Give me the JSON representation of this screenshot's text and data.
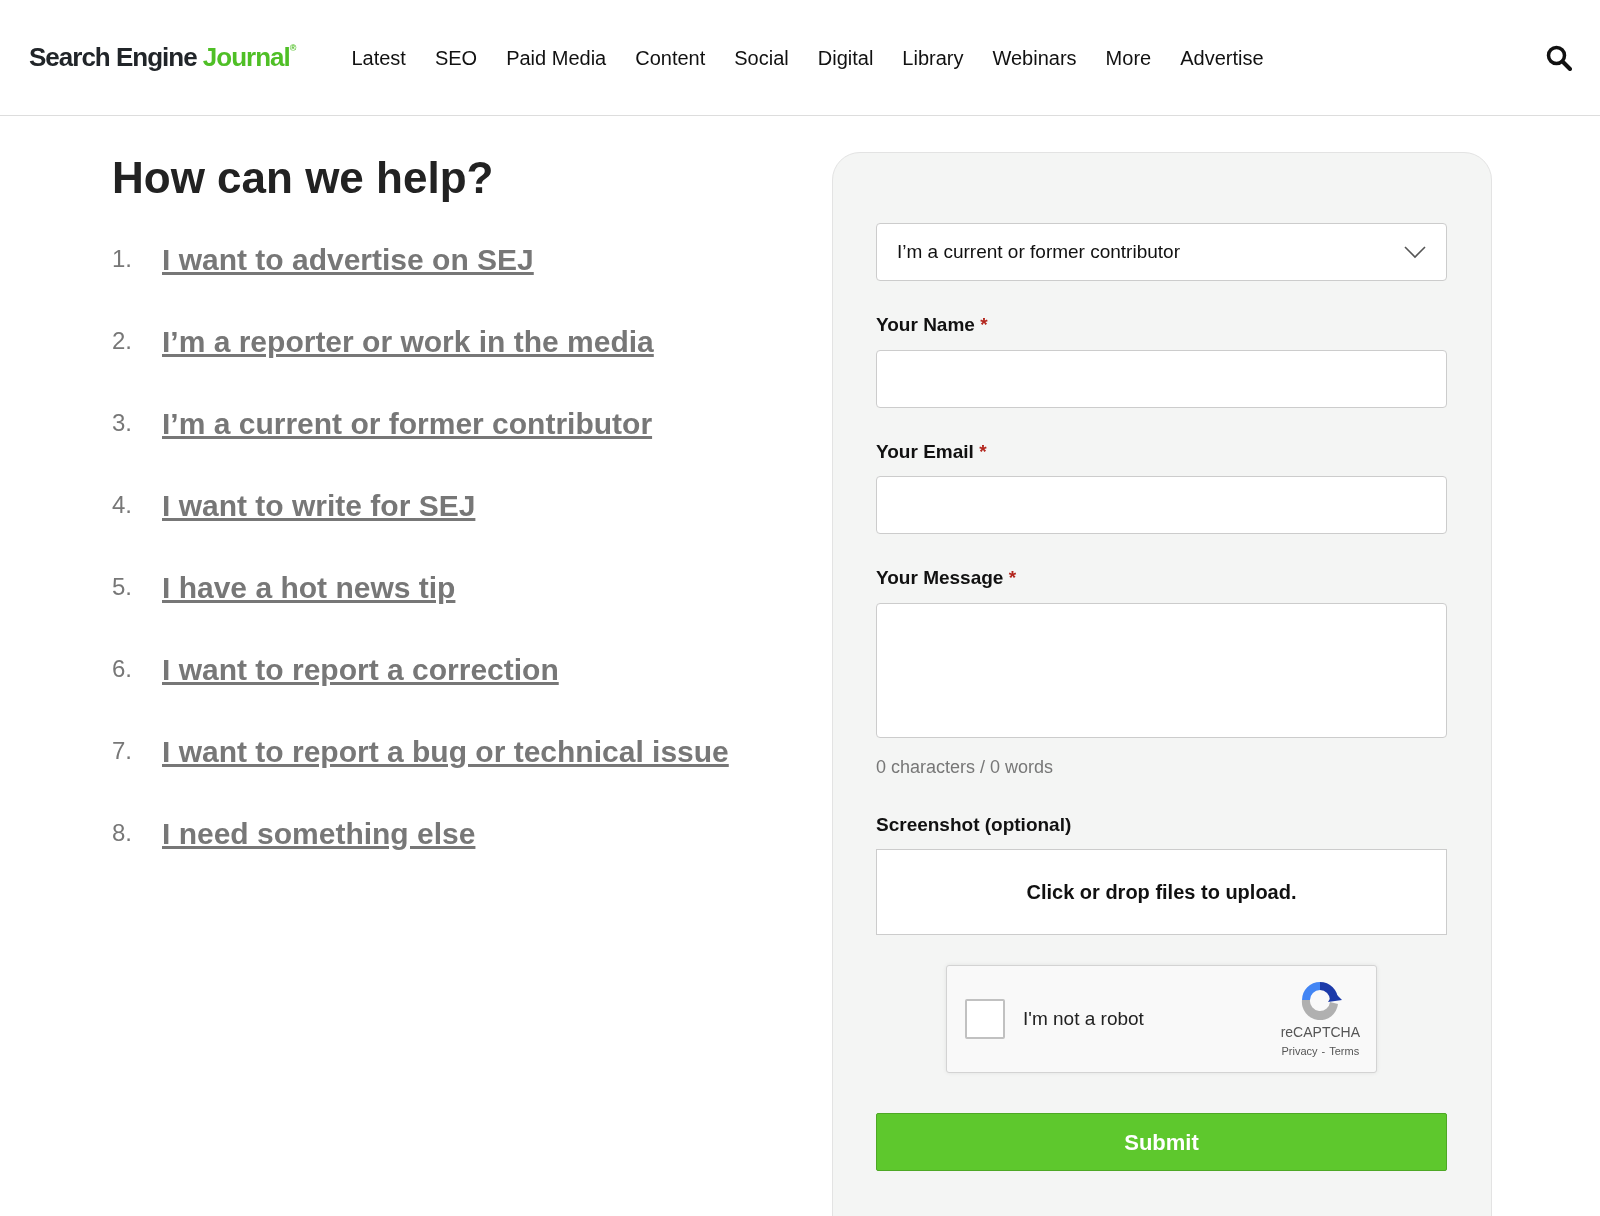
{
  "header": {
    "logo": {
      "part_1": "Search Engine",
      "part_2": "Journal",
      "mark": "®"
    },
    "nav": [
      "Latest",
      "SEO",
      "Paid Media",
      "Content",
      "Social",
      "Digital",
      "Library",
      "Webinars",
      "More",
      "Advertise"
    ]
  },
  "help": {
    "title": "How can we help?",
    "options": [
      {
        "number": "1.",
        "label": "I want to advertise on SEJ"
      },
      {
        "number": "2.",
        "label": "I’m a reporter or work in the media"
      },
      {
        "number": "3.",
        "label": "I’m a current or former contributor"
      },
      {
        "number": "4.",
        "label": "I want to write for SEJ"
      },
      {
        "number": "5.",
        "label": "I have a hot news tip"
      },
      {
        "number": "6.",
        "label": "I want to report a correction"
      },
      {
        "number": "7.",
        "label": "I want to report a bug or technical issue"
      },
      {
        "number": "8.",
        "label": "I need something else"
      }
    ]
  },
  "form": {
    "topic_select": {
      "value": "I’m a current or former contributor"
    },
    "fields": [
      {
        "kind": "text",
        "label": "Your Name",
        "required_mark": "*"
      },
      {
        "kind": "text",
        "label": "Your Email",
        "required_mark": "*"
      },
      {
        "kind": "textarea",
        "label": "Your Message",
        "required_mark": "*",
        "counter": "0 characters / 0 words"
      },
      {
        "kind": "upload",
        "label": "Screenshot (optional)",
        "prompt": "Click or drop files to upload."
      }
    ],
    "captcha": {
      "label": "I'm not a robot",
      "checked": false,
      "brand": "reCAPTCHA",
      "privacy": "Privacy",
      "separator": "-",
      "terms": "Terms"
    },
    "submit": "Submit"
  }
}
